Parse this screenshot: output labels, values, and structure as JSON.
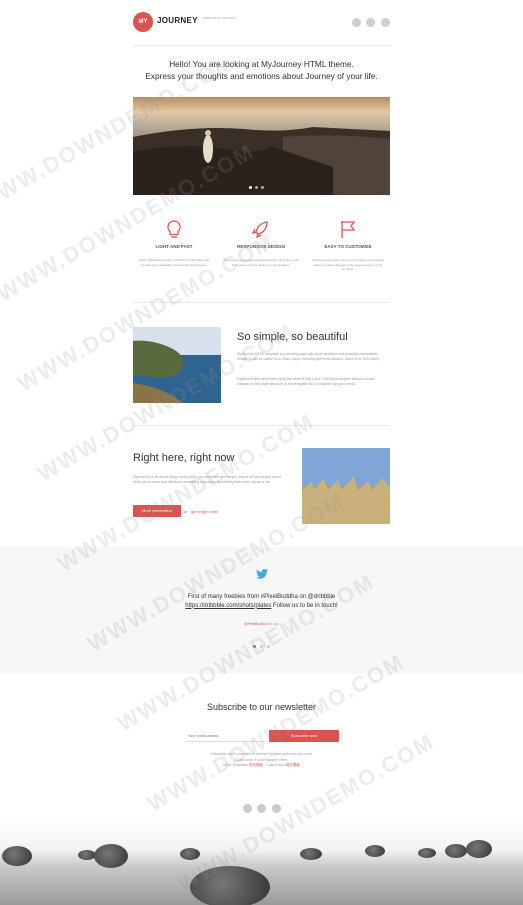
{
  "header": {
    "logo_circle": "MY",
    "logo_text": "JOURNEY",
    "tagline": "WEBSITE IN ANOTHER"
  },
  "intro": {
    "line1": "Hello! You are looking at MyJourney HTML theme.",
    "line2": "Express your thoughts and emotions about Journey of your life."
  },
  "features": [
    {
      "icon": "bulb-icon",
      "title": "LIGHT AND FAST",
      "text": "Clean & Beautiful Design, HTML5 & CSS3 valid code provide good readability and smooth performance."
    },
    {
      "icon": "rocket-icon",
      "title": "RESPONSIVE DESIGN",
      "text": "Responsive designed and Retina Ready. MyJourney will look perfect on any device you can imagine."
    },
    {
      "icon": "flag-icon",
      "title": "EASY TO CUSTOMIZE",
      "text": "Optimised and valid code using the latest technologies allows to make changes in the page structure of the template."
    }
  ],
  "simple": {
    "title": "So simple, so beautiful",
    "p1": "MyJourney HTML template is a landing page with clean structure and beautiful minimalistic design. It can be useful in so many ways, including the most obvious, which is to Tell a story.",
    "p2": "Optimised and valid code using the latest HTML5 and CSS3 technologies allows to make changes in the page structure of the template as it is required by your needs."
  },
  "right_now": {
    "title": "Right here, right now",
    "text": "MyJourney is all about being useful when you need one and simple way to tell the people about what you've seen and felt about something important. Something that made impact a lot.",
    "button": "More information",
    "or": "or",
    "link": "get it right now!"
  },
  "twitter": {
    "line1": "First of many freebies from #PixelBuddha on @dribbble",
    "link": "https://dribbble.com/shots/plates",
    "line2": "Follow us to be in touch!",
    "handle": "@PixelBuddha",
    "time": "6d ago"
  },
  "newsletter": {
    "title": "Subscribe to our newsletter",
    "placeholder": "Your email adress",
    "button": "Subscribe now",
    "note1": "Subscribe now if you want to receive updates and news via email.",
    "note2": "Don't worry, it won't happen often.",
    "note3_prefix": "More Templates",
    "note3_link1": "网页模板",
    "note3_mid": "- Collect from",
    "note3_link2": "网页模板"
  },
  "watermark": "WWW.DOWNDEMO.COM",
  "colors": {
    "accent": "#d9534f",
    "band": "#f7f7f7"
  }
}
